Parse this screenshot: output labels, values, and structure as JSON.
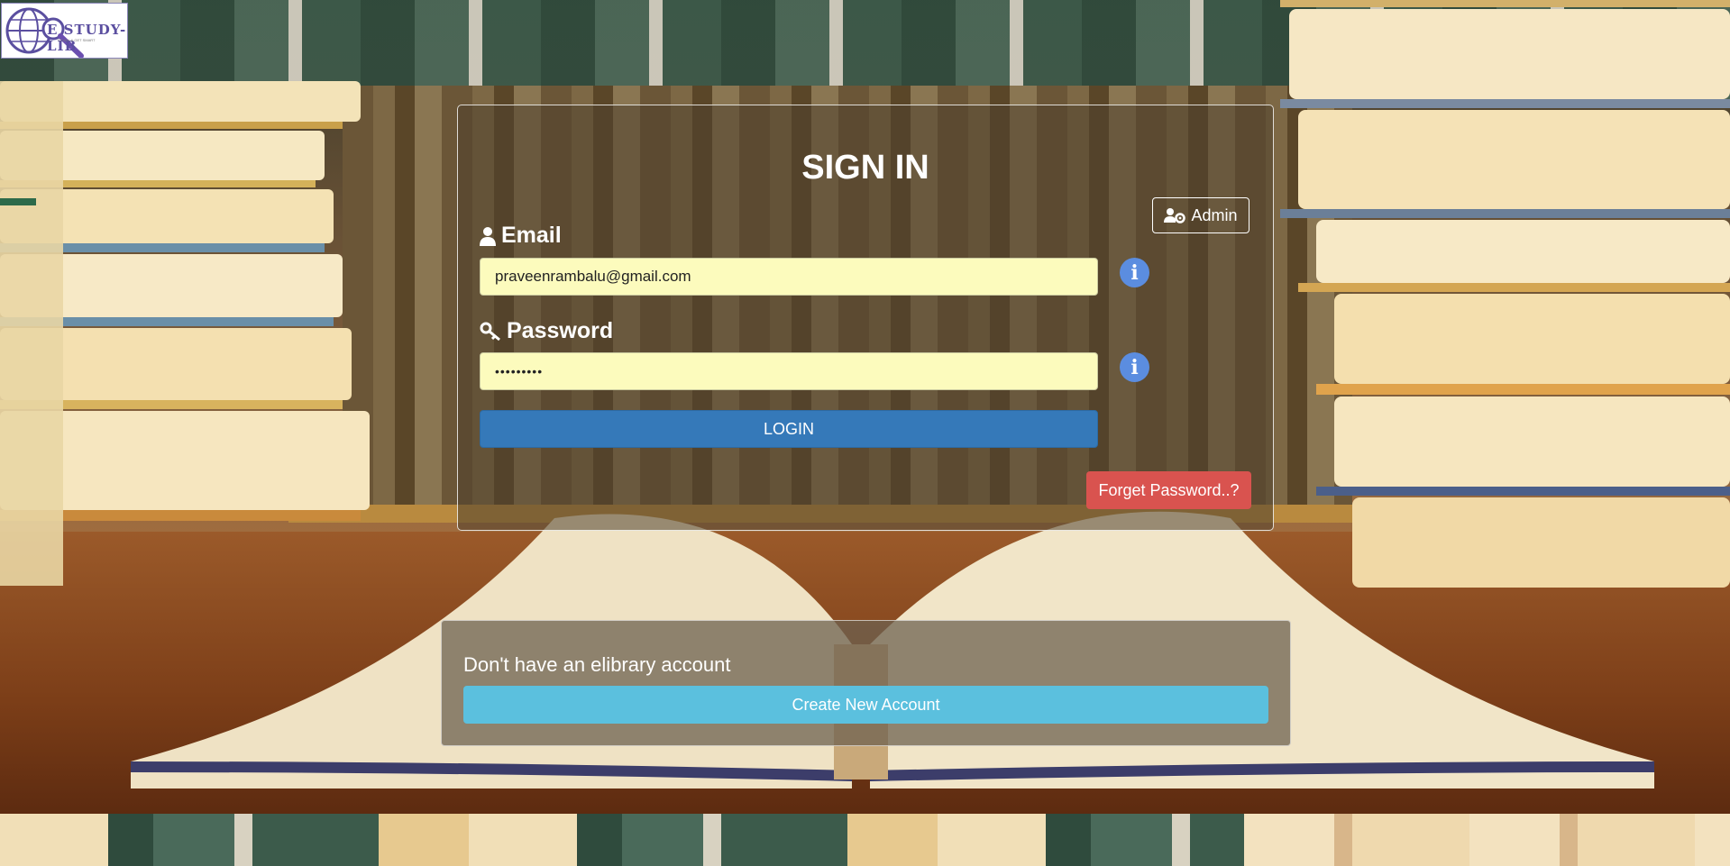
{
  "logo": {
    "text": "E STUDY-LIB",
    "tagline": "STUDY & GET SMART"
  },
  "signin": {
    "title": "SIGN IN",
    "admin_label": "Admin",
    "email_label": "Email",
    "email_value": "praveenrambalu@gmail.com",
    "password_label": "Password",
    "password_value": "•••••••••",
    "login_label": "LOGIN",
    "forget_label": "Forget Password..?"
  },
  "register": {
    "prompt": "Don't have an elibrary account",
    "create_label": "Create New Account"
  },
  "colors": {
    "field_bg": "#fcfbbd",
    "login": "#3579b9",
    "forget": "#d9534f",
    "create": "#5bc0de",
    "info": "#5b8de0"
  },
  "icons": {
    "admin": "users-cog-icon",
    "email": "user-icon",
    "password": "key-icon",
    "info": "info-circle-icon"
  }
}
